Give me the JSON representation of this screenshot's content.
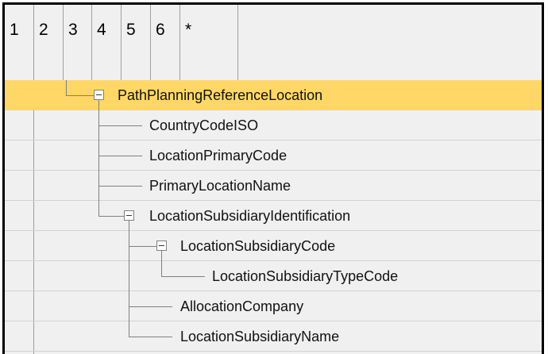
{
  "columns": [
    "1",
    "2",
    "3",
    "4",
    "5",
    "6",
    "*"
  ],
  "tree": [
    {
      "label": "PathPlanningReferenceLocation",
      "selected": true,
      "expanded": true
    },
    {
      "label": "CountryCodeISO"
    },
    {
      "label": "LocationPrimaryCode"
    },
    {
      "label": "PrimaryLocationName"
    },
    {
      "label": "LocationSubsidiaryIdentification",
      "expanded": true
    },
    {
      "label": "LocationSubsidiaryCode",
      "expanded": true
    },
    {
      "label": "LocationSubsidiaryTypeCode"
    },
    {
      "label": "AllocationCompany"
    },
    {
      "label": "LocationSubsidiaryName"
    }
  ],
  "colors": {
    "selection": "#ffd766",
    "background": "#f0f0f0",
    "grid": "#a0a0a0"
  },
  "icons": {
    "collapse": "minus-box-icon"
  }
}
